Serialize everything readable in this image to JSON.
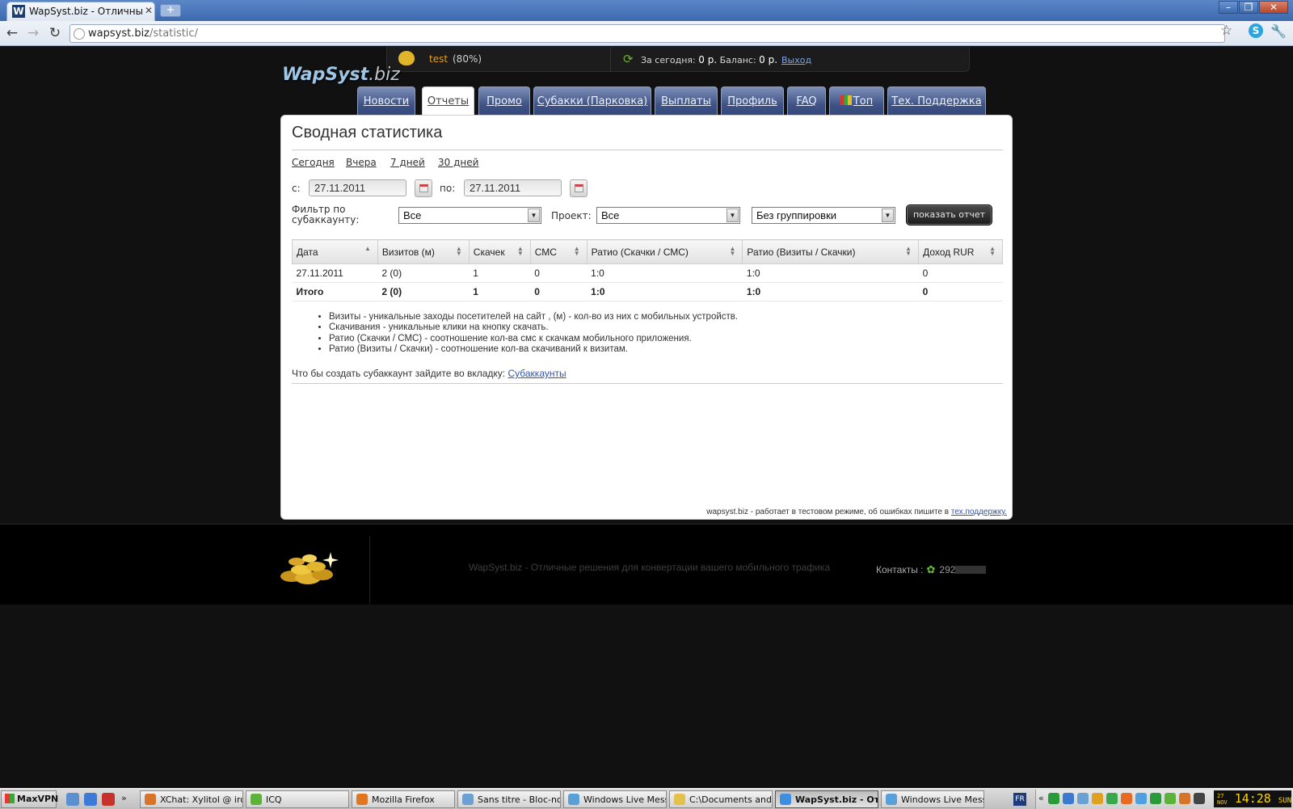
{
  "browser": {
    "tab_title": "WapSyst.biz - Отличные реш",
    "tab_close": "✕",
    "new_tab": "+",
    "url_host": "wapsyst.biz",
    "url_path": "/statistic/"
  },
  "userbar": {
    "username": "test",
    "percent": "(80%)",
    "today_label": "За сегодня:",
    "today_value": "0 р.",
    "balance_label": "Баланс:",
    "balance_value": "0 р.",
    "logout": "Выход"
  },
  "logo": {
    "main": "WapSyst",
    "sub": ".biz"
  },
  "nav": [
    {
      "label": "Новости",
      "active": false
    },
    {
      "label": "Отчеты",
      "active": true
    },
    {
      "label": "Промо",
      "active": false
    },
    {
      "label": "Субакки (Парковка)",
      "active": false
    },
    {
      "label": "Выплаты",
      "active": false
    },
    {
      "label": "Профиль",
      "active": false
    },
    {
      "label": "FAQ",
      "active": false
    },
    {
      "label": "Топ",
      "active": false
    },
    {
      "label": "Тех. Поддержка",
      "active": false
    }
  ],
  "main": {
    "title": "Сводная статистика",
    "periods": [
      "Сегодня",
      "Вчера",
      "7 дней",
      "30 дней"
    ],
    "from_label": "с:",
    "from_date": "27.11.2011",
    "to_label": "по:",
    "to_date": "27.11.2011",
    "filter_label": "Фильтр по субаккаунту:",
    "filter_value": "Все",
    "project_label": "Проект:",
    "project_value": "Все",
    "grouping_value": "Без группировки",
    "show_button": "показать отчет"
  },
  "table": {
    "headers": [
      "Дата",
      "Визитов (м)",
      "Скачек",
      "СМС",
      "Ратио (Скачки / СМС)",
      "Ратио (Визиты / Скачки)",
      "Доход RUR"
    ],
    "rows": [
      [
        "27.11.2011",
        "2 (0)",
        "1",
        "0",
        "1:0",
        "1:0",
        "0"
      ]
    ],
    "total": [
      "Итого",
      "2 (0)",
      "1",
      "0",
      "1:0",
      "1:0",
      "0"
    ]
  },
  "legend": [
    "Визиты - уникальные заходы посетителей на сайт , (м) - кол-во из них с мобильных устройств.",
    "Скачивания - уникальные клики на кнопку скачать.",
    "Ратио (Скачки / СМС) - соотношение кол-ва смс к скачкам мобильного приложения.",
    "Ратио (Визиты / Скачки) - соотношение кол-ва скачиваний к визитам."
  ],
  "sub_note": {
    "text": "Что бы создать субаккаунт зайдите во вкладку:",
    "link": "Субаккаунты"
  },
  "footnote": {
    "text": "wapsyst.biz - работает в тестовом режиме, об ошибках пишите в",
    "link": "тех.поддержку."
  },
  "footer": {
    "slogan": "WapSyst.biz - Отличные решения для конвертации вашего мобильного трафика",
    "contacts_label": "Контакты :",
    "contact_number": "292"
  },
  "taskbar": {
    "start": "MaxVPN",
    "tasks": [
      {
        "label": "XChat: Xylitol @ irc....",
        "active": false,
        "color": "#d8732a"
      },
      {
        "label": "ICQ",
        "active": false,
        "color": "#5db33a"
      },
      {
        "label": "Mozilla Firefox",
        "active": false,
        "color": "#e0761d"
      },
      {
        "label": "Sans titre - Bloc-notes",
        "active": false,
        "color": "#6aa0d4"
      },
      {
        "label": "Windows Live Mess...",
        "active": false,
        "color": "#5aa0d8"
      },
      {
        "label": "C:\\Documents and ...",
        "active": false,
        "color": "#e4c14a"
      },
      {
        "label": "WapSyst.biz - От...",
        "active": true,
        "color": "#3d8ee0"
      },
      {
        "label": "Windows Live Mess...",
        "active": false,
        "color": "#5aa0d8"
      }
    ],
    "lang": "FR",
    "clock_date_day": "27",
    "clock_date_month": "NOV",
    "clock_time": "14:28",
    "clock_weekday": "SUN"
  }
}
